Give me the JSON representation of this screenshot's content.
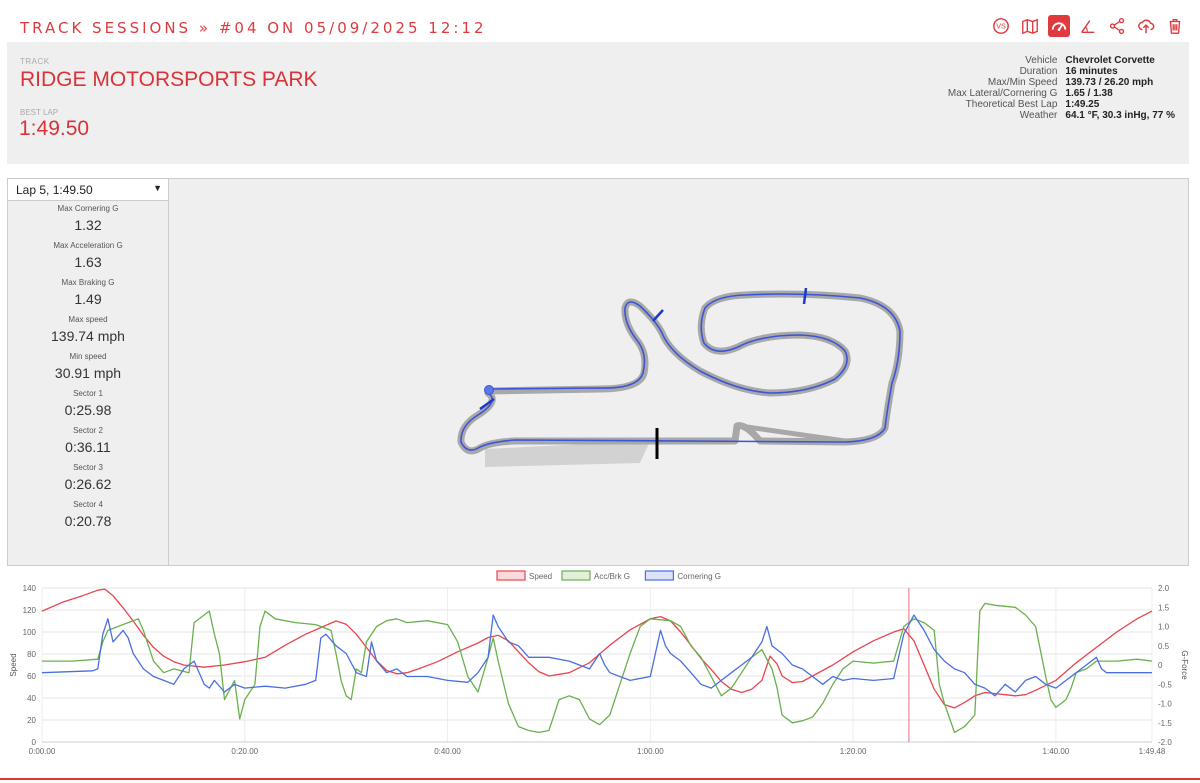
{
  "breadcrumb": {
    "section": "TRACK SESSIONS",
    "sep": "»",
    "session": "#04 ON 05/09/2025 12:12"
  },
  "toolbar": {
    "icons": [
      "vs-icon",
      "map-icon",
      "dashboard-icon",
      "angle-icon",
      "share-icon",
      "cloud-upload-icon",
      "trash-icon"
    ],
    "active": "dashboard-icon",
    "vs_label": "VS"
  },
  "header": {
    "track_label": "TRACK",
    "track_name": "RIDGE MOTORSPORTS PARK",
    "best_lap_label": "BEST LAP",
    "best_lap": "1:49.50"
  },
  "session_stats": [
    {
      "k": "Vehicle",
      "v": "Chevrolet Corvette"
    },
    {
      "k": "Duration",
      "v": "16 minutes"
    },
    {
      "k": "Max/Min Speed",
      "v": "139.73 / 26.20 mph"
    },
    {
      "k": "Max Lateral/Cornering G",
      "v": "1.65 / 1.38"
    },
    {
      "k": "Theoretical Best Lap",
      "v": "1:49.25"
    },
    {
      "k": "Weather",
      "v": "64.1 °F, 30.3 inHg, 77 %"
    }
  ],
  "lap_select": {
    "value": "Lap 5, 1:49.50"
  },
  "lap_stats": [
    {
      "k": "Max Cornering G",
      "v": "1.32"
    },
    {
      "k": "Max Acceleration G",
      "v": "1.63"
    },
    {
      "k": "Max Braking G",
      "v": "1.49"
    },
    {
      "k": "Max speed",
      "v": "139.74 mph"
    },
    {
      "k": "Min speed",
      "v": "30.91 mph"
    },
    {
      "k": "Sector 1",
      "v": "0:25.98"
    },
    {
      "k": "Sector 2",
      "v": "0:36.11"
    },
    {
      "k": "Sector 3",
      "v": "0:26.62"
    },
    {
      "k": "Sector 4",
      "v": "0:20.78"
    }
  ],
  "colors": {
    "accent": "#e0393e",
    "speed": "#e8454f",
    "accbrk": "#6ab04c",
    "cornering": "#4a6fe0",
    "track_gray": "#a8a8a8",
    "lap_line": "#3b55d9"
  },
  "chart_data": {
    "type": "line",
    "x_ticks": [
      "0:00.00",
      "0:20.00",
      "0:40.00",
      "1:00.00",
      "1:20.00",
      "1:40.00",
      "1:49.48"
    ],
    "x_tick_seconds": [
      0,
      20,
      40,
      60,
      80,
      100,
      109.48
    ],
    "xlim": [
      0,
      109.48
    ],
    "ylabel": "Speed",
    "ylabel_right": "G-Force",
    "ylim": [
      0,
      140
    ],
    "y_ticks": [
      0,
      20,
      40,
      60,
      80,
      100,
      120,
      140
    ],
    "ylim_right": [
      -2.0,
      2.0
    ],
    "y_ticks_right": [
      "-2.0",
      "-1.5",
      "-1.0",
      "-0.5",
      "0",
      "0.5",
      "1.0",
      "1.5",
      "2.0"
    ],
    "legend_position": "top",
    "cursor_x": 85.5,
    "series": [
      {
        "name": "Speed",
        "axis": "left",
        "points": [
          [
            0,
            119
          ],
          [
            2,
            127
          ],
          [
            4,
            133
          ],
          [
            5.5,
            138
          ],
          [
            6.2,
            139
          ],
          [
            7,
            133
          ],
          [
            8,
            122
          ],
          [
            9,
            110
          ],
          [
            10,
            97
          ],
          [
            11,
            86
          ],
          [
            12,
            78
          ],
          [
            13,
            73
          ],
          [
            14,
            70
          ],
          [
            16,
            68
          ],
          [
            18,
            70
          ],
          [
            20,
            73
          ],
          [
            22,
            77
          ],
          [
            24,
            88
          ],
          [
            26,
            98
          ],
          [
            28,
            106
          ],
          [
            29,
            110
          ],
          [
            30,
            107
          ],
          [
            31,
            98
          ],
          [
            32,
            86
          ],
          [
            33,
            74
          ],
          [
            34,
            65
          ],
          [
            35,
            62
          ],
          [
            36,
            63
          ],
          [
            37,
            66
          ],
          [
            39,
            73
          ],
          [
            41,
            82
          ],
          [
            43,
            90
          ],
          [
            44,
            95
          ],
          [
            45,
            97
          ],
          [
            46,
            92
          ],
          [
            47,
            82
          ],
          [
            48,
            72
          ],
          [
            49,
            64
          ],
          [
            50,
            60
          ],
          [
            52,
            63
          ],
          [
            54,
            72
          ],
          [
            56,
            88
          ],
          [
            58,
            102
          ],
          [
            60,
            112
          ],
          [
            61,
            114
          ],
          [
            62,
            110
          ],
          [
            63,
            100
          ],
          [
            64,
            88
          ],
          [
            65,
            76
          ],
          [
            66,
            66
          ],
          [
            67,
            55
          ],
          [
            68,
            48
          ],
          [
            69,
            45
          ],
          [
            70,
            48
          ],
          [
            71,
            56
          ],
          [
            71.8,
            78
          ],
          [
            72.5,
            71
          ],
          [
            73,
            60
          ],
          [
            74,
            54
          ],
          [
            75,
            55
          ],
          [
            76,
            60
          ],
          [
            78,
            70
          ],
          [
            80,
            82
          ],
          [
            82,
            92
          ],
          [
            84,
            100
          ],
          [
            85,
            103
          ],
          [
            86,
            92
          ],
          [
            87,
            70
          ],
          [
            88,
            48
          ],
          [
            89,
            34
          ],
          [
            90,
            31
          ],
          [
            91,
            36
          ],
          [
            92,
            42
          ],
          [
            93,
            45
          ],
          [
            94,
            44
          ],
          [
            95,
            43
          ],
          [
            96,
            42
          ],
          [
            97,
            43
          ],
          [
            98,
            47
          ],
          [
            100,
            56
          ],
          [
            102,
            72
          ],
          [
            104,
            86
          ],
          [
            106,
            100
          ],
          [
            108,
            112
          ],
          [
            109.48,
            119
          ]
        ]
      },
      {
        "name": "Acc/Brk G",
        "axis": "right",
        "points": [
          [
            0,
            0.1
          ],
          [
            3,
            0.1
          ],
          [
            5.5,
            0.15
          ],
          [
            6,
            0.6
          ],
          [
            6.5,
            0.9
          ],
          [
            7.5,
            1.0
          ],
          [
            8.5,
            1.1
          ],
          [
            9.5,
            1.2
          ],
          [
            10,
            0.9
          ],
          [
            11,
            0.1
          ],
          [
            12,
            -0.2
          ],
          [
            13,
            -0.1
          ],
          [
            14.5,
            -0.2
          ],
          [
            15,
            1.1
          ],
          [
            16.5,
            1.4
          ],
          [
            17,
            0.8
          ],
          [
            17.5,
            0.3
          ],
          [
            18,
            -0.9
          ],
          [
            19,
            -0.4
          ],
          [
            19.5,
            -1.4
          ],
          [
            20,
            -0.9
          ],
          [
            21,
            -0.5
          ],
          [
            21.5,
            1.0
          ],
          [
            22,
            1.4
          ],
          [
            23,
            1.2
          ],
          [
            25,
            1.1
          ],
          [
            27,
            1.05
          ],
          [
            28.5,
            0.9
          ],
          [
            29,
            0.3
          ],
          [
            29.5,
            -0.4
          ],
          [
            30,
            -0.8
          ],
          [
            30.5,
            -0.9
          ],
          [
            31,
            -0.1
          ],
          [
            31.5,
            -0.2
          ],
          [
            32,
            0.6
          ],
          [
            33,
            1.0
          ],
          [
            34,
            1.15
          ],
          [
            35,
            1.2
          ],
          [
            36,
            1.1
          ],
          [
            38,
            1.15
          ],
          [
            40,
            1.05
          ],
          [
            41,
            0.6
          ],
          [
            42,
            -0.3
          ],
          [
            43,
            -0.7
          ],
          [
            44,
            0.2
          ],
          [
            44.5,
            0.7
          ],
          [
            45,
            0.1
          ],
          [
            46,
            -1.0
          ],
          [
            47,
            -1.6
          ],
          [
            48,
            -1.7
          ],
          [
            49,
            -1.75
          ],
          [
            50,
            -1.7
          ],
          [
            51,
            -0.9
          ],
          [
            52,
            -0.8
          ],
          [
            53,
            -0.9
          ],
          [
            54,
            -1.4
          ],
          [
            55,
            -1.55
          ],
          [
            56,
            -1.3
          ],
          [
            57,
            -0.5
          ],
          [
            58,
            0.3
          ],
          [
            59,
            1.0
          ],
          [
            60,
            1.2
          ],
          [
            62,
            1.15
          ],
          [
            63,
            1.0
          ],
          [
            64,
            0.5
          ],
          [
            65,
            0.2
          ],
          [
            66,
            -0.3
          ],
          [
            67,
            -0.8
          ],
          [
            68,
            -0.6
          ],
          [
            69,
            -0.2
          ],
          [
            70,
            0.2
          ],
          [
            71,
            0.4
          ],
          [
            72,
            -0.1
          ],
          [
            72.5,
            -0.6
          ],
          [
            73,
            -1.3
          ],
          [
            74,
            -1.5
          ],
          [
            75,
            -1.45
          ],
          [
            76,
            -1.35
          ],
          [
            77,
            -1.0
          ],
          [
            78,
            -0.5
          ],
          [
            79,
            -0.1
          ],
          [
            80,
            0.1
          ],
          [
            82,
            0.05
          ],
          [
            84,
            0.1
          ],
          [
            85,
            1.0
          ],
          [
            86,
            1.2
          ],
          [
            87,
            1.1
          ],
          [
            88,
            0.9
          ],
          [
            88.5,
            -0.5
          ],
          [
            89,
            -1.0
          ],
          [
            90,
            -1.75
          ],
          [
            91,
            -1.6
          ],
          [
            92,
            -1.3
          ],
          [
            92.5,
            1.4
          ],
          [
            93,
            1.6
          ],
          [
            94,
            1.55
          ],
          [
            96,
            1.5
          ],
          [
            97,
            1.3
          ],
          [
            98,
            1.0
          ],
          [
            99,
            -0.3
          ],
          [
            99.5,
            -0.9
          ],
          [
            100,
            -1.1
          ],
          [
            101,
            -0.9
          ],
          [
            101.5,
            -0.6
          ],
          [
            102,
            -0.2
          ],
          [
            103,
            -0.1
          ],
          [
            104,
            0.1
          ],
          [
            106,
            0.1
          ],
          [
            108,
            0.15
          ],
          [
            109.48,
            0.1
          ]
        ]
      },
      {
        "name": "Cornering G",
        "axis": "right",
        "points": [
          [
            0,
            -0.2
          ],
          [
            5,
            -0.15
          ],
          [
            5.5,
            -0.1
          ],
          [
            6,
            0.8
          ],
          [
            6.5,
            1.2
          ],
          [
            7,
            0.6
          ],
          [
            8,
            0.9
          ],
          [
            8.5,
            0.7
          ],
          [
            9,
            0.3
          ],
          [
            10,
            -0.1
          ],
          [
            11,
            -0.3
          ],
          [
            12,
            -0.4
          ],
          [
            13,
            -0.5
          ],
          [
            14,
            -0.1
          ],
          [
            15,
            0.1
          ],
          [
            16,
            -0.5
          ],
          [
            16.5,
            -0.6
          ],
          [
            17,
            -0.4
          ],
          [
            18,
            -0.7
          ],
          [
            19,
            -0.5
          ],
          [
            20,
            -0.6
          ],
          [
            22,
            -0.55
          ],
          [
            24,
            -0.6
          ],
          [
            26,
            -0.5
          ],
          [
            27,
            -0.4
          ],
          [
            27.5,
            0.7
          ],
          [
            28,
            0.8
          ],
          [
            29,
            0.5
          ],
          [
            30,
            0.3
          ],
          [
            31,
            -0.2
          ],
          [
            32,
            -0.3
          ],
          [
            32.5,
            0.6
          ],
          [
            33,
            0.1
          ],
          [
            34,
            -0.2
          ],
          [
            35,
            -0.1
          ],
          [
            36,
            -0.3
          ],
          [
            38,
            -0.3
          ],
          [
            40,
            -0.4
          ],
          [
            42,
            -0.45
          ],
          [
            43,
            -0.2
          ],
          [
            44,
            0.2
          ],
          [
            44.5,
            1.3
          ],
          [
            45,
            1.0
          ],
          [
            46,
            0.6
          ],
          [
            47,
            0.5
          ],
          [
            48,
            0.2
          ],
          [
            50,
            0.2
          ],
          [
            52,
            0.1
          ],
          [
            54,
            -0.1
          ],
          [
            55,
            0.3
          ],
          [
            55.5,
            0.0
          ],
          [
            56,
            -0.2
          ],
          [
            58,
            -0.4
          ],
          [
            60,
            -0.3
          ],
          [
            61,
            0.9
          ],
          [
            61.5,
            0.5
          ],
          [
            62,
            0.3
          ],
          [
            63,
            0.1
          ],
          [
            64,
            -0.2
          ],
          [
            65,
            -0.5
          ],
          [
            66,
            -0.6
          ],
          [
            67,
            -0.4
          ],
          [
            68,
            -0.2
          ],
          [
            69,
            0.0
          ],
          [
            70,
            0.2
          ],
          [
            71,
            0.6
          ],
          [
            71.5,
            1.0
          ],
          [
            72,
            0.5
          ],
          [
            73,
            0.3
          ],
          [
            74,
            0.0
          ],
          [
            75,
            -0.1
          ],
          [
            76,
            -0.3
          ],
          [
            77,
            -0.5
          ],
          [
            78,
            -0.3
          ],
          [
            79,
            -0.4
          ],
          [
            80,
            -0.35
          ],
          [
            82,
            -0.4
          ],
          [
            84,
            -0.35
          ],
          [
            85,
            0.8
          ],
          [
            86,
            1.3
          ],
          [
            87,
            0.9
          ],
          [
            88,
            0.4
          ],
          [
            89,
            0.1
          ],
          [
            90,
            -0.1
          ],
          [
            91,
            -0.2
          ],
          [
            92,
            -0.5
          ],
          [
            93,
            -0.6
          ],
          [
            94,
            -0.8
          ],
          [
            95,
            -0.5
          ],
          [
            96,
            -0.7
          ],
          [
            97,
            -0.4
          ],
          [
            98,
            -0.3
          ],
          [
            99,
            -0.5
          ],
          [
            100,
            -0.6
          ],
          [
            101,
            -0.4
          ],
          [
            102,
            -0.2
          ],
          [
            103,
            0.0
          ],
          [
            104,
            0.2
          ],
          [
            104.5,
            -0.1
          ],
          [
            105,
            -0.2
          ],
          [
            107,
            -0.2
          ],
          [
            109.48,
            -0.2
          ]
        ]
      }
    ]
  }
}
